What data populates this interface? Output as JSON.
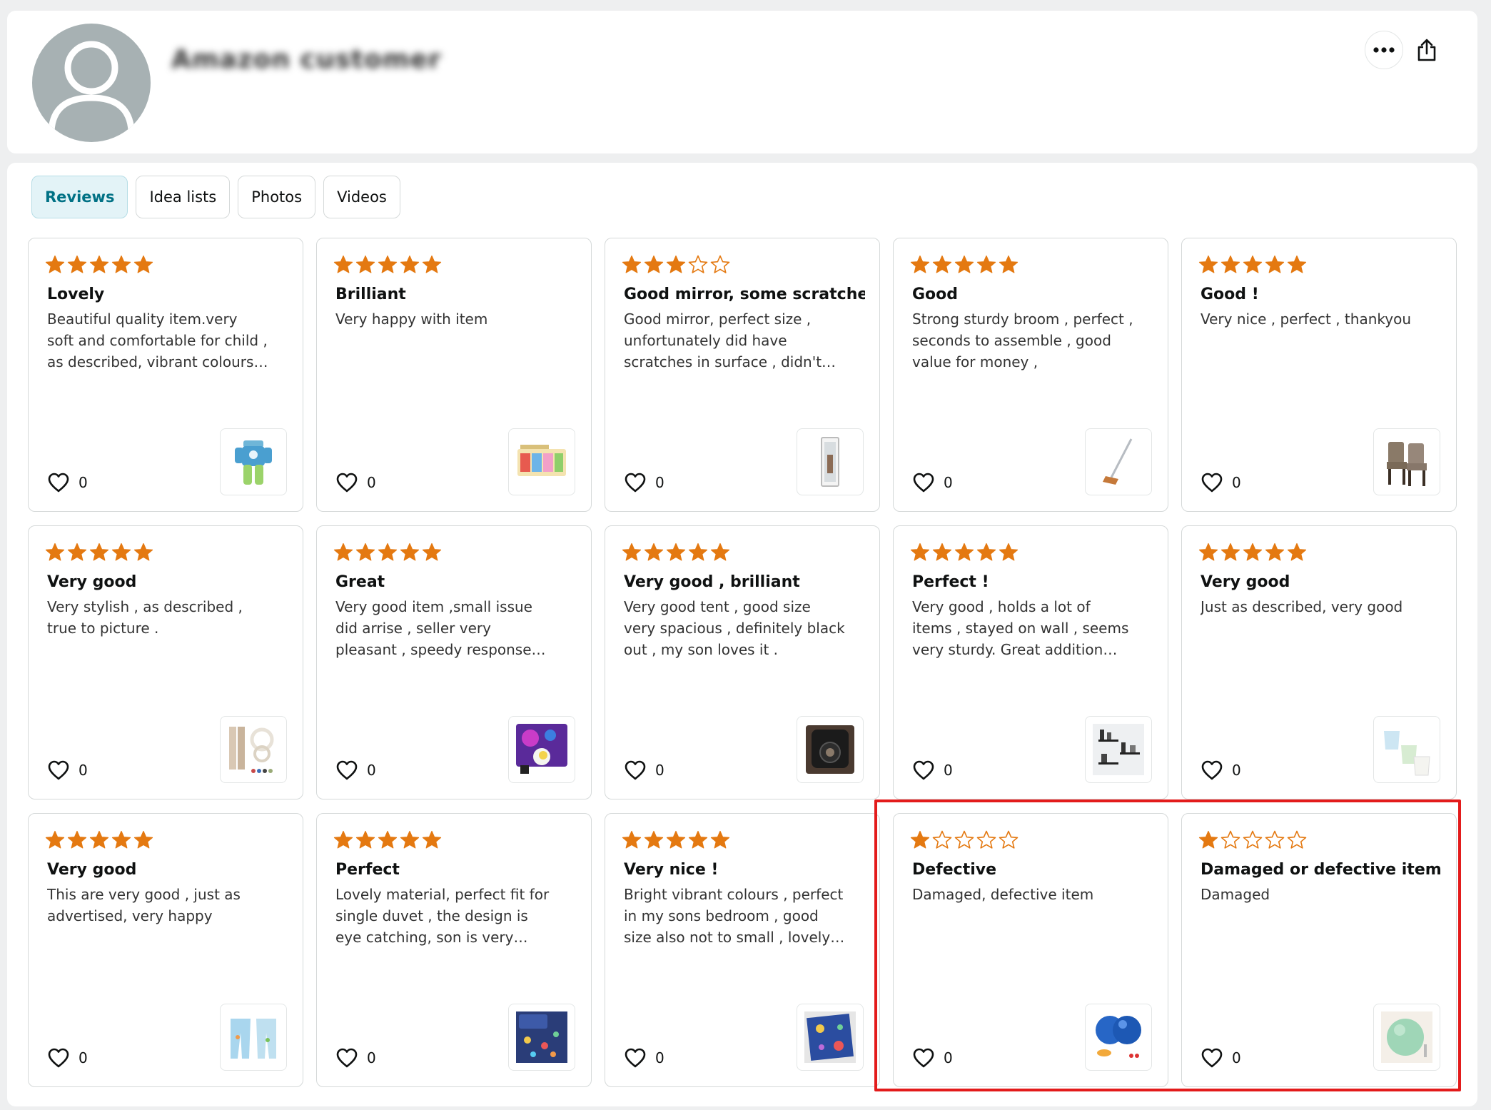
{
  "profile": {
    "name": "Amazon customer"
  },
  "tabs": [
    {
      "label": "Reviews",
      "active": true
    },
    {
      "label": "Idea lists",
      "active": false
    },
    {
      "label": "Photos",
      "active": false
    },
    {
      "label": "Videos",
      "active": false
    }
  ],
  "colors": {
    "star": "#e47911",
    "tab_active_bg": "#e3f3f7",
    "tab_active_text": "#007185",
    "avatar": "#a7b1b3",
    "highlight": "#e31b1b"
  },
  "reviews": [
    {
      "rating": 5,
      "title": "Lovely",
      "body": "Beautiful quality item.very soft and comfortable for child , as described, vibrant colours, I…",
      "likes": "0",
      "thumb": "kids-pajamas-icon"
    },
    {
      "rating": 5,
      "title": "Brilliant",
      "body": "Very happy with item",
      "likes": "0",
      "thumb": "book-set-icon"
    },
    {
      "rating": 3,
      "title": "Good mirror, some scratches",
      "body": "Good mirror, perfect size , unfortunately did have scratches in surface , didn't want hassle o…",
      "likes": "0",
      "thumb": "mirror-icon"
    },
    {
      "rating": 5,
      "title": "Good",
      "body": "Strong sturdy broom , perfect , seconds to assemble , good value for money ,",
      "likes": "0",
      "thumb": "broom-icon"
    },
    {
      "rating": 5,
      "title": "Good !",
      "body": "Very nice , perfect , thankyou",
      "likes": "0",
      "thumb": "dining-chairs-icon"
    },
    {
      "rating": 5,
      "title": "Very good",
      "body": "Very stylish , as described , true to picture .",
      "likes": "0",
      "thumb": "curtain-tiebacks-icon"
    },
    {
      "rating": 5,
      "title": "Great",
      "body": "Very good item ,small issue did arrise , seller very pleasant , speedy response and satisfacto…",
      "likes": "0",
      "thumb": "galaxy-projector-icon"
    },
    {
      "rating": 5,
      "title": "Very good , brilliant",
      "body": "Very good tent , good size very spacious , definitely black out , my son loves it .",
      "likes": "0",
      "thumb": "blackout-tent-icon"
    },
    {
      "rating": 5,
      "title": "Perfect !",
      "body": "Very good , holds a lot of items , stayed on wall , seems very sturdy. Great addition to…",
      "likes": "0",
      "thumb": "wall-shelves-icon"
    },
    {
      "rating": 5,
      "title": "Very good",
      "body": "Just as described, very good",
      "likes": "0",
      "thumb": "glass-pots-icon"
    },
    {
      "rating": 5,
      "title": "Very good",
      "body": "This are very good , just as advertised, very happy",
      "likes": "0",
      "thumb": "kids-trousers-icon"
    },
    {
      "rating": 5,
      "title": "Perfect",
      "body": "Lovely material, perfect fit for single duvet , the design is eye catching, son is very happy,…",
      "likes": "0",
      "thumb": "duvet-set-icon"
    },
    {
      "rating": 5,
      "title": "Very nice !",
      "body": "Bright vibrant colours , perfect in my sons bedroom , good size also not to small , lovely soft materi…",
      "likes": "0",
      "thumb": "space-rug-icon"
    },
    {
      "rating": 1,
      "title": "Defective",
      "body": "Damaged, defective item",
      "likes": "0",
      "thumb": "exercise-balls-icon"
    },
    {
      "rating": 1,
      "title": "Damaged or defective item",
      "body": "Damaged",
      "likes": "0",
      "thumb": "yoga-ball-icon"
    }
  ]
}
